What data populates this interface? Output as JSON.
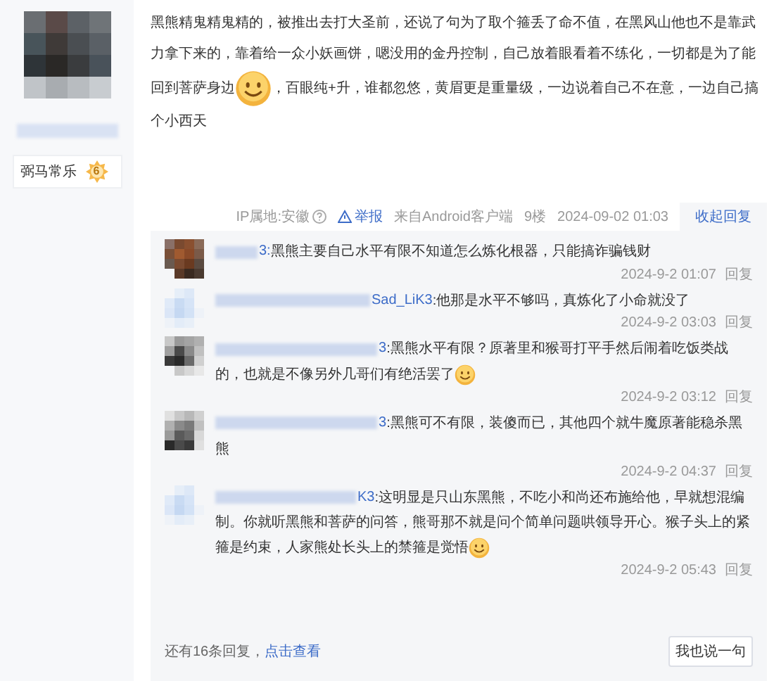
{
  "author": {
    "badge": {
      "title": "弼马常乐",
      "level": "6"
    }
  },
  "post": {
    "content": [
      {
        "kind": "text",
        "text": "黑熊精鬼精鬼精的，被推出去打大圣前，还说了句为了取个箍丢了命不值，在黑风山他也不是靠武力拿下来的，靠着给一众小妖画饼，嗯没用的金丹控制，自己放着眼看着不练化，一切都是为了能回到菩萨身边"
      },
      {
        "kind": "emoji"
      },
      {
        "kind": "text",
        "text": "，百眼纯+升，谁都忽悠，黄眉更是重量级，一边说着自己不在意，一边自己搞个小西天"
      }
    ],
    "footer": {
      "ip": "IP属地:安徽",
      "report": "举报",
      "source": "来自Android客户端",
      "floor": "9楼",
      "time": "2024-09-02 01:03",
      "collapse": "收起回复"
    }
  },
  "replies": [
    {
      "author_tail": "3:",
      "content": [
        {
          "kind": "text",
          "text": "黑熊主要自己水平有限不知道怎么炼化根器，只能搞诈骗钱财"
        }
      ],
      "time": "2024-9-2 01:07",
      "reply": "回复"
    },
    {
      "author_tail": "Sad_LiK3",
      "content": [
        {
          "kind": "text",
          "text": ":他那是水平不够吗，真炼化了小命就没了"
        }
      ],
      "time": "2024-9-2 03:03",
      "reply": "回复"
    },
    {
      "author_tail": "3",
      "content": [
        {
          "kind": "text",
          "text": ":黑熊水平有限？原著里和猴哥打平手然后闹着吃饭类战的，也就是不像另外几哥们有绝活罢了"
        },
        {
          "kind": "emoji"
        }
      ],
      "time": "2024-9-2 03:12",
      "reply": "回复"
    },
    {
      "author_tail": "3",
      "content": [
        {
          "kind": "text",
          "text": ":黑熊可不有限，装傻而已，其他四个就牛魔原著能稳杀黑熊"
        }
      ],
      "time": "2024-9-2 04:37",
      "reply": "回复"
    },
    {
      "author_tail": "K3",
      "content": [
        {
          "kind": "text",
          "text": ":这明显是只山东黑熊，不吃小和尚还布施给他，早就想混编制。你就听黑熊和菩萨的问答，熊哥那不就是问个简单问题哄领导开心。猴子头上的紧箍是约束，人家熊处长头上的禁箍是觉悟"
        },
        {
          "kind": "emoji"
        }
      ],
      "time": "2024-9-2 05:43",
      "reply": "回复"
    }
  ],
  "more": {
    "text": "还有16条回复，",
    "link": "点击查看"
  },
  "say_button": "我也说一句"
}
